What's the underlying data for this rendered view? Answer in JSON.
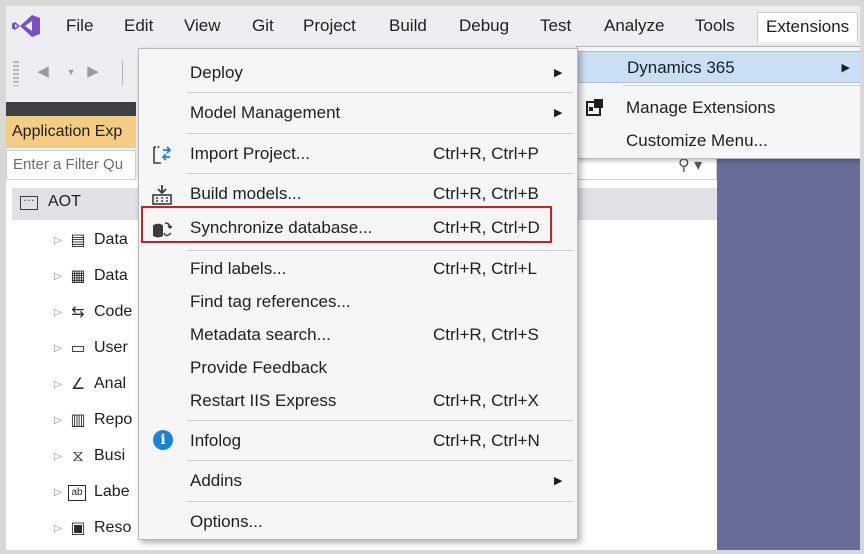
{
  "menubar": {
    "items": [
      "File",
      "Edit",
      "View",
      "Git",
      "Project",
      "Build",
      "Debug",
      "Test",
      "Analyze",
      "Tools",
      "Extensions"
    ],
    "active": "Extensions"
  },
  "explorer": {
    "title": "Application Exp",
    "filter_placeholder": "Enter a Filter Qu",
    "root": "AOT",
    "items": [
      {
        "label": "Data",
        "icon": "data-model-icon"
      },
      {
        "label": "Data",
        "icon": "data-types-icon"
      },
      {
        "label": "Code",
        "icon": "code-icon"
      },
      {
        "label": "User",
        "icon": "user-interface-icon"
      },
      {
        "label": "Anal",
        "icon": "analytics-icon"
      },
      {
        "label": "Repo",
        "icon": "reports-icon"
      },
      {
        "label": "Busi",
        "icon": "business-process-icon"
      },
      {
        "label": "Labe",
        "icon": "labels-icon"
      },
      {
        "label": "Reso",
        "icon": "resources-icon"
      }
    ]
  },
  "extensions_menu": {
    "items": [
      {
        "label": "Dynamics 365",
        "submenu": true,
        "highlighted": true
      },
      {
        "label": "Manage Extensions",
        "icon": "manage-extensions-icon"
      },
      {
        "label": "Customize Menu..."
      }
    ]
  },
  "dynamics_menu": {
    "items": [
      {
        "label": "Deploy",
        "shortcut": "",
        "submenu": true
      },
      {
        "label": "Model Management",
        "shortcut": "",
        "submenu": true
      },
      {
        "label": "Import Project...",
        "shortcut": "Ctrl+R, Ctrl+P",
        "icon": "import-project-icon"
      },
      {
        "label": "Build models...",
        "shortcut": "Ctrl+R, Ctrl+B",
        "icon": "build-models-icon"
      },
      {
        "label": "Synchronize database...",
        "shortcut": "Ctrl+R, Ctrl+D",
        "icon": "synchronize-database-icon",
        "outlined": true
      },
      {
        "label": "Find labels...",
        "shortcut": "Ctrl+R, Ctrl+L"
      },
      {
        "label": "Find tag references...",
        "shortcut": ""
      },
      {
        "label": "Metadata search...",
        "shortcut": "Ctrl+R, Ctrl+S"
      },
      {
        "label": "Provide Feedback",
        "shortcut": ""
      },
      {
        "label": "Restart IIS Express",
        "shortcut": "Ctrl+R, Ctrl+X"
      },
      {
        "label": "Infolog",
        "shortcut": "Ctrl+R, Ctrl+N",
        "icon": "info-icon"
      },
      {
        "label": "Addins",
        "shortcut": "",
        "submenu": true
      },
      {
        "label": "Options...",
        "shortcut": ""
      }
    ]
  },
  "colors": {
    "accent_highlight": "#c9dff5",
    "outline": "#cc1f1f",
    "panel_header": "#f5cc84",
    "dark_region": "#686c99",
    "info_blue": "#1b83d6"
  }
}
